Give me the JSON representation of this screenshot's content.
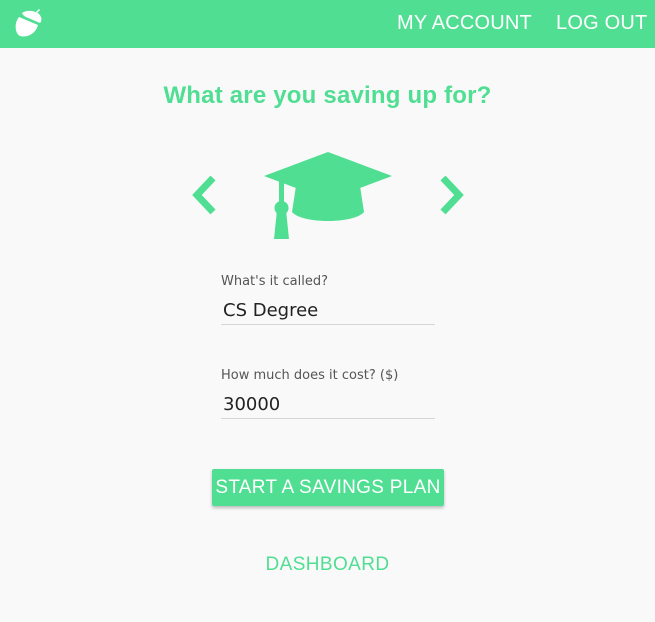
{
  "colors": {
    "brand_green": "#50de93",
    "header_text": "#ffffff",
    "background": "#f9f9f9"
  },
  "header": {
    "logo_icon": "acorn-icon",
    "nav": {
      "my_account": "MY ACCOUNT",
      "log_out": "LOG OUT"
    }
  },
  "main": {
    "title": "What are you saving up for?",
    "goal_carousel": {
      "prev_icon": "chevron-left-icon",
      "next_icon": "chevron-right-icon",
      "current_icon": "graduation-cap-icon"
    },
    "form": {
      "name_label": "What's it called?",
      "name_value": "CS Degree",
      "cost_label": "How much does it cost? ($)",
      "cost_value": "30000"
    },
    "start_button": "START A SAVINGS PLAN",
    "dashboard_link": "DASHBOARD"
  }
}
